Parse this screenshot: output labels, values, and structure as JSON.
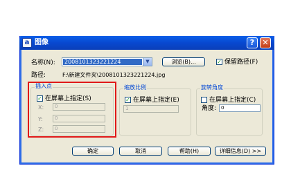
{
  "window": {
    "title": "图像",
    "app_icon_letter": "a",
    "help_glyph": "?",
    "close_glyph": "✕"
  },
  "name_row": {
    "label": "名称(N):",
    "value": "2008101323221224",
    "browse_button": "浏览(B)...",
    "keep_path_label": "保留路径(F)",
    "keep_path_checked": true
  },
  "path_row": {
    "label": "路径:",
    "value": "F:\\新建文件夹\\2008101323221224.jpg"
  },
  "insertion_point": {
    "title": "插入点",
    "on_screen_label": "在屏幕上指定(S)",
    "on_screen_checked": true,
    "x_label": "X:",
    "x_value": "0",
    "y_label": "Y:",
    "y_value": "0",
    "z_label": "Z:",
    "z_value": "0"
  },
  "scale": {
    "title": "缩放比例",
    "on_screen_label": "在屏幕上指定(E)",
    "on_screen_checked": true,
    "value": "1"
  },
  "rotation": {
    "title": "旋转角度",
    "on_screen_label": "在屏幕上指定(C)",
    "on_screen_checked": false,
    "angle_label": "角度:",
    "angle_value": "0"
  },
  "buttons": {
    "ok": "确定",
    "cancel": "取消",
    "help": "帮助(H)",
    "details": "详细信息(D) >>"
  },
  "colors": {
    "titlebar": "#0a5fe8",
    "dialog_bg": "#ece9d8",
    "group_title": "#0046d5",
    "highlight_box": "#e01818"
  }
}
